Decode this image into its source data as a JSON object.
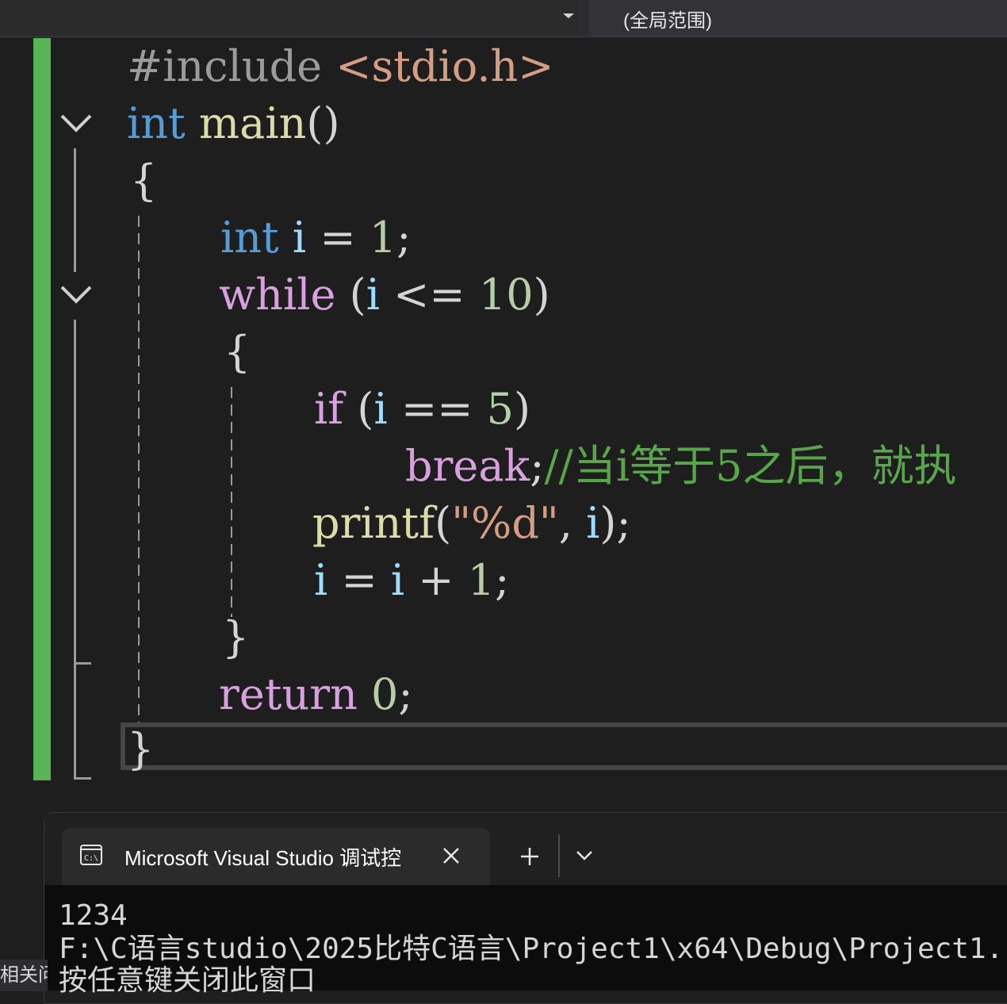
{
  "toolbar": {
    "scope_label": "(全局范围)"
  },
  "code": {
    "line1": {
      "a": "#include ",
      "b": "<stdio.h>"
    },
    "line2": {
      "a": "int",
      "b": " ",
      "c": "main",
      "d": "()"
    },
    "line3": {
      "a": "{"
    },
    "line4": {
      "a": "int",
      "b": " ",
      "c": "i",
      "d": " = ",
      "e": "1",
      "f": ";"
    },
    "line5": {
      "a": "while",
      "b": " (",
      "c": "i",
      "d": " <= ",
      "e": "10",
      "f": ")"
    },
    "line6": {
      "a": "{"
    },
    "line7": {
      "a": "if",
      "b": " (",
      "c": "i",
      "d": " == ",
      "e": "5",
      "f": ")"
    },
    "line8": {
      "a": "break",
      "b": ";",
      "c": "//当i等于5之后，就执"
    },
    "line9": {
      "a": "printf",
      "b": "(",
      "c": "\"%d\"",
      "d": ", ",
      "e": "i",
      "f": ");"
    },
    "line10": {
      "a": "i",
      "b": " = ",
      "c": "i",
      "d": " + ",
      "e": "1",
      "f": ";"
    },
    "line11": {
      "a": "}"
    },
    "line12": {
      "a": "return",
      "b": " ",
      "c": "0",
      "d": ";"
    },
    "line13": {
      "a": "}"
    }
  },
  "console": {
    "tab_title": "Microsoft Visual Studio 调试控",
    "output": [
      "1234",
      "F:\\C语言studio\\2025比特C语言\\Project1\\x64\\Debug\\Project1.",
      "按任意键关闭此窗口"
    ]
  },
  "statusbar": {
    "left_text": "相关问"
  },
  "colors": {
    "change_bar": "#57b557",
    "keyword": "#569cd6",
    "control": "#d8a0df",
    "function": "#dcdcaa",
    "variable": "#9cdcfe",
    "number": "#b5cea8",
    "string": "#d69d85",
    "comment": "#57a64a"
  },
  "icons": {
    "fold": "chevron-down-icon",
    "console": "console-app-icon",
    "close": "close-icon",
    "add": "plus-icon",
    "menu": "chevron-down-icon"
  }
}
